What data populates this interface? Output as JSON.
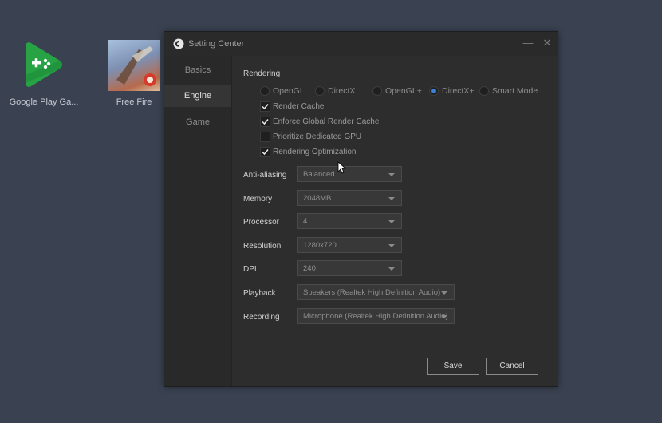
{
  "desktop": {
    "icons": [
      {
        "label": "Google Play Ga...",
        "icon": "google-play-games-icon"
      },
      {
        "label": "Free Fire",
        "icon": "free-fire-icon"
      }
    ]
  },
  "dialog": {
    "title": "Setting Center",
    "controls": {
      "minimize": "—",
      "close": "✕"
    },
    "sidebar": [
      {
        "label": "Basics",
        "active": false
      },
      {
        "label": "Engine",
        "active": true
      },
      {
        "label": "Game",
        "active": false
      }
    ],
    "rendering": {
      "title": "Rendering",
      "modes": [
        {
          "label": "OpenGL",
          "checked": false
        },
        {
          "label": "DirectX",
          "checked": false
        },
        {
          "label": "OpenGL+",
          "checked": false
        },
        {
          "label": "DirectX+",
          "checked": true
        },
        {
          "label": "Smart Mode",
          "checked": false
        }
      ],
      "options": [
        {
          "label": "Render Cache",
          "checked": true
        },
        {
          "label": "Enforce Global Render Cache",
          "checked": true
        },
        {
          "label": "Prioritize Dedicated GPU",
          "checked": false
        },
        {
          "label": "Rendering Optimization",
          "checked": true
        }
      ]
    },
    "settings": [
      {
        "label": "Anti-aliasing",
        "value": "Balanced"
      },
      {
        "label": "Memory",
        "value": "2048MB"
      },
      {
        "label": "Processor",
        "value": "4"
      },
      {
        "label": "Resolution",
        "value": "1280x720"
      },
      {
        "label": "DPI",
        "value": "240"
      },
      {
        "label": "Playback",
        "value": "Speakers (Realtek High Definition Audio)"
      },
      {
        "label": "Recording",
        "value": "Microphone (Realtek High Definition Audio)"
      }
    ],
    "buttons": {
      "save": "Save",
      "cancel": "Cancel"
    }
  },
  "colors": {
    "desktop_bg": "#3a4252",
    "dialog_bg": "#2d2d2d",
    "accent": "#3b7fd6",
    "play_green": "#27a345"
  }
}
